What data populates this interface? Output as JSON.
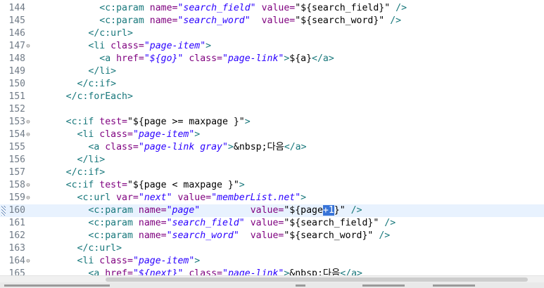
{
  "editor": {
    "lines": [
      {
        "n": "144",
        "fold": false,
        "current": false,
        "tokens": [
          {
            "t": "            "
          },
          {
            "t": "<c:param ",
            "c": "tag"
          },
          {
            "t": "name=",
            "c": "attr"
          },
          {
            "t": "\"search_field\"",
            "c": "val"
          },
          {
            "t": " "
          },
          {
            "t": "value=",
            "c": "attr"
          },
          {
            "t": "\"${search_field}\"",
            "c": "plain"
          },
          {
            "t": " />",
            "c": "tag"
          }
        ]
      },
      {
        "n": "145",
        "fold": false,
        "current": false,
        "tokens": [
          {
            "t": "            "
          },
          {
            "t": "<c:param ",
            "c": "tag"
          },
          {
            "t": "name=",
            "c": "attr"
          },
          {
            "t": "\"search_word\"",
            "c": "val"
          },
          {
            "t": "  "
          },
          {
            "t": "value=",
            "c": "attr"
          },
          {
            "t": "\"${search_word}\"",
            "c": "plain"
          },
          {
            "t": " />",
            "c": "tag"
          }
        ]
      },
      {
        "n": "146",
        "fold": false,
        "current": false,
        "tokens": [
          {
            "t": "          "
          },
          {
            "t": "</c:url>",
            "c": "tag"
          }
        ]
      },
      {
        "n": "147",
        "fold": true,
        "current": false,
        "tokens": [
          {
            "t": "          "
          },
          {
            "t": "<li ",
            "c": "tag"
          },
          {
            "t": "class=",
            "c": "attr"
          },
          {
            "t": "\"page-item\"",
            "c": "val"
          },
          {
            "t": ">",
            "c": "tag"
          }
        ]
      },
      {
        "n": "148",
        "fold": false,
        "current": false,
        "tokens": [
          {
            "t": "            "
          },
          {
            "t": "<a ",
            "c": "tag"
          },
          {
            "t": "href=",
            "c": "attr"
          },
          {
            "t": "\"${go}\"",
            "c": "val"
          },
          {
            "t": " "
          },
          {
            "t": "class=",
            "c": "attr"
          },
          {
            "t": "\"page-link\"",
            "c": "val"
          },
          {
            "t": ">",
            "c": "tag"
          },
          {
            "t": "${a}",
            "c": "plain"
          },
          {
            "t": "</a>",
            "c": "tag"
          }
        ]
      },
      {
        "n": "149",
        "fold": false,
        "current": false,
        "tokens": [
          {
            "t": "          "
          },
          {
            "t": "</li>",
            "c": "tag"
          }
        ]
      },
      {
        "n": "150",
        "fold": false,
        "current": false,
        "tokens": [
          {
            "t": "        "
          },
          {
            "t": "</c:if>",
            "c": "tag"
          }
        ]
      },
      {
        "n": "151",
        "fold": false,
        "current": false,
        "tokens": [
          {
            "t": "      "
          },
          {
            "t": "</c:forEach>",
            "c": "tag"
          }
        ]
      },
      {
        "n": "152",
        "fold": false,
        "current": false,
        "tokens": []
      },
      {
        "n": "153",
        "fold": true,
        "current": false,
        "tokens": [
          {
            "t": "      "
          },
          {
            "t": "<c:if ",
            "c": "tag"
          },
          {
            "t": "test=",
            "c": "attr"
          },
          {
            "t": "\"${page >= maxpage }\"",
            "c": "plain"
          },
          {
            "t": ">",
            "c": "tag"
          }
        ]
      },
      {
        "n": "154",
        "fold": true,
        "current": false,
        "tokens": [
          {
            "t": "        "
          },
          {
            "t": "<li ",
            "c": "tag"
          },
          {
            "t": "class=",
            "c": "attr"
          },
          {
            "t": "\"page-item\"",
            "c": "val"
          },
          {
            "t": ">",
            "c": "tag"
          }
        ]
      },
      {
        "n": "155",
        "fold": false,
        "current": false,
        "tokens": [
          {
            "t": "          "
          },
          {
            "t": "<a ",
            "c": "tag"
          },
          {
            "t": "class=",
            "c": "attr"
          },
          {
            "t": "\"page-link gray\"",
            "c": "val"
          },
          {
            "t": ">",
            "c": "tag"
          },
          {
            "t": "&nbsp;다음",
            "c": "plain"
          },
          {
            "t": "</a>",
            "c": "tag"
          }
        ]
      },
      {
        "n": "156",
        "fold": false,
        "current": false,
        "tokens": [
          {
            "t": "        "
          },
          {
            "t": "</li>",
            "c": "tag"
          }
        ]
      },
      {
        "n": "157",
        "fold": false,
        "current": false,
        "tokens": [
          {
            "t": "      "
          },
          {
            "t": "</c:if>",
            "c": "tag"
          }
        ]
      },
      {
        "n": "158",
        "fold": true,
        "current": false,
        "tokens": [
          {
            "t": "      "
          },
          {
            "t": "<c:if ",
            "c": "tag"
          },
          {
            "t": "test=",
            "c": "attr"
          },
          {
            "t": "\"${page < maxpage }\"",
            "c": "plain"
          },
          {
            "t": ">",
            "c": "tag"
          }
        ]
      },
      {
        "n": "159",
        "fold": true,
        "current": false,
        "tokens": [
          {
            "t": "        "
          },
          {
            "t": "<c:url ",
            "c": "tag"
          },
          {
            "t": "var=",
            "c": "attr"
          },
          {
            "t": "\"next\"",
            "c": "val"
          },
          {
            "t": " "
          },
          {
            "t": "value=",
            "c": "attr"
          },
          {
            "t": "\"memberList.net\"",
            "c": "val"
          },
          {
            "t": ">",
            "c": "tag"
          }
        ]
      },
      {
        "n": "160",
        "fold": false,
        "current": true,
        "marker": true,
        "tokens": [
          {
            "t": "          "
          },
          {
            "t": "<c:param ",
            "c": "tag"
          },
          {
            "t": "name=",
            "c": "attr"
          },
          {
            "t": "\"page\"",
            "c": "val"
          },
          {
            "t": "         "
          },
          {
            "t": "value=",
            "c": "attr"
          },
          {
            "t": "\"${page",
            "c": "plain"
          },
          {
            "t": "+1",
            "c": "sel"
          },
          {
            "t": "}\"",
            "c": "plain"
          },
          {
            "t": " />",
            "c": "tag"
          }
        ]
      },
      {
        "n": "161",
        "fold": false,
        "current": false,
        "tokens": [
          {
            "t": "          "
          },
          {
            "t": "<c:param ",
            "c": "tag"
          },
          {
            "t": "name=",
            "c": "attr"
          },
          {
            "t": "\"search_field\"",
            "c": "val"
          },
          {
            "t": " "
          },
          {
            "t": "value=",
            "c": "attr"
          },
          {
            "t": "\"${search_field}\"",
            "c": "plain"
          },
          {
            "t": " />",
            "c": "tag"
          }
        ]
      },
      {
        "n": "162",
        "fold": false,
        "current": false,
        "tokens": [
          {
            "t": "          "
          },
          {
            "t": "<c:param ",
            "c": "tag"
          },
          {
            "t": "name=",
            "c": "attr"
          },
          {
            "t": "\"search_word\"",
            "c": "val"
          },
          {
            "t": "  "
          },
          {
            "t": "value=",
            "c": "attr"
          },
          {
            "t": "\"${search_word}\"",
            "c": "plain"
          },
          {
            "t": " />",
            "c": "tag"
          }
        ]
      },
      {
        "n": "163",
        "fold": false,
        "current": false,
        "tokens": [
          {
            "t": "        "
          },
          {
            "t": "</c:url>",
            "c": "tag"
          }
        ]
      },
      {
        "n": "164",
        "fold": true,
        "current": false,
        "tokens": [
          {
            "t": "        "
          },
          {
            "t": "<li ",
            "c": "tag"
          },
          {
            "t": "class=",
            "c": "attr"
          },
          {
            "t": "\"page-item\"",
            "c": "val"
          },
          {
            "t": ">",
            "c": "tag"
          }
        ]
      },
      {
        "n": "165",
        "fold": false,
        "current": false,
        "tokens": [
          {
            "t": "          "
          },
          {
            "t": "<a ",
            "c": "tag"
          },
          {
            "t": "href=",
            "c": "attr"
          },
          {
            "t": "\"${next}\"",
            "c": "val"
          },
          {
            "t": " "
          },
          {
            "t": "class=",
            "c": "attr"
          },
          {
            "t": "\"page-link\"",
            "c": "val"
          },
          {
            "t": ">",
            "c": "tag"
          },
          {
            "t": "&nbsp;다음",
            "c": "plain"
          },
          {
            "t": "</a>",
            "c": "tag"
          }
        ]
      }
    ],
    "fold_icon": "fold-minus-icon",
    "colors": {
      "tag": "#17777b",
      "attribute": "#7f007f",
      "string": "#2a00ff",
      "line_number": "#6f7a86",
      "current_line": "#e8f2fe",
      "selection": "#3874d8"
    }
  }
}
